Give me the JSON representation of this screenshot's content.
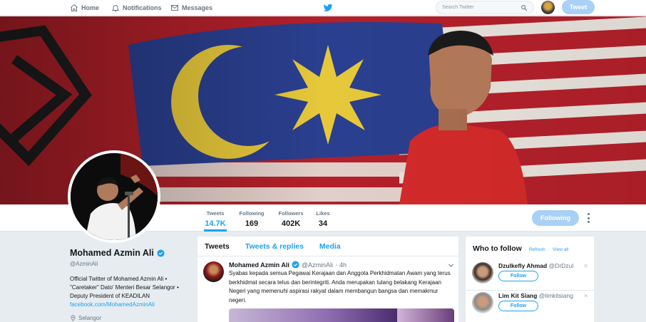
{
  "nav": {
    "home": "Home",
    "notifications": "Notifications",
    "messages": "Messages",
    "search_placeholder": "Search Twitter",
    "tweet_button": "Tweet"
  },
  "stats": [
    {
      "label": "Tweets",
      "value": "14.7K"
    },
    {
      "label": "Following",
      "value": "169"
    },
    {
      "label": "Followers",
      "value": "402K"
    },
    {
      "label": "Likes",
      "value": "34"
    }
  ],
  "following_button": "Following",
  "profile": {
    "name": "Mohamed Azmin Ali",
    "handle": "@AzminAli",
    "bio": "Official Twitter of Mohamed Azmin Ali • \"Caretaker\" Dato' Menteri Besar Selangor • Deputy President of KEADILAN",
    "link": "facebook.com/MohamedAzminAli",
    "location": "Selangor"
  },
  "timeline": {
    "tabs": [
      "Tweets",
      "Tweets & replies",
      "Media"
    ],
    "tweet": {
      "name": "Mohamed Azmin Ali",
      "handle": "@AzminAli",
      "separator": "·",
      "time": "4h",
      "text": "Syabas kepada semua Pegawai Kerajaan dan Anggota Perkhidmatan Awam yang terus berkhidmat secara telus dan berintegriti. Anda merupakan tulang belakang Kerajaan Negeri yang memenuhi aspirasi rakyat dalam membangun bangsa dan memakmur negeri."
    }
  },
  "who_to_follow": {
    "title": "Who to follow",
    "refresh": "Refresh",
    "dot": "·",
    "view_all": "View all",
    "follow_label": "Follow",
    "close": "×",
    "users": [
      {
        "name": "Dzulkefly Ahmad",
        "handle": "@DrDzul"
      },
      {
        "name": "Lim Kit Siang",
        "handle": "@limkitsiang"
      }
    ]
  },
  "colors": {
    "accent": "#1da1f2",
    "accent_light": "#a9d0f5",
    "page_bg": "#e6ecf0"
  }
}
